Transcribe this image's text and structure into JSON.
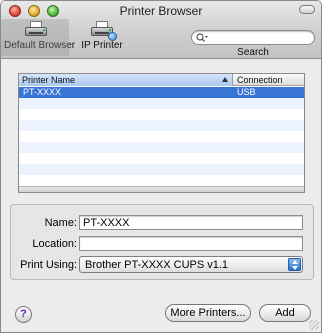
{
  "window": {
    "title": "Printer Browser"
  },
  "toolbar": {
    "items": [
      {
        "label": "Default Browser",
        "icon": "printer-icon",
        "selected": true
      },
      {
        "label": "IP Printer",
        "icon": "network-printer-icon",
        "selected": false
      }
    ],
    "search": {
      "placeholder": "",
      "value": "",
      "label": "Search"
    }
  },
  "table": {
    "columns": [
      "Printer Name",
      "Connection"
    ],
    "rows": [
      {
        "name": "PT-XXXX",
        "connection": "USB",
        "selected": true
      }
    ]
  },
  "form": {
    "name_label": "Name:",
    "name_value": "PT-XXXX",
    "location_label": "Location:",
    "location_value": "",
    "print_using_label": "Print Using:",
    "print_using_value": "Brother PT-XXXX   CUPS v1.1"
  },
  "buttons": {
    "help": "?",
    "more_printers": "More Printers...",
    "add": "Add"
  },
  "colors": {
    "selection": "#3875d7",
    "alt_row": "#edf3fe",
    "help_glyph": "#6a28b8"
  }
}
